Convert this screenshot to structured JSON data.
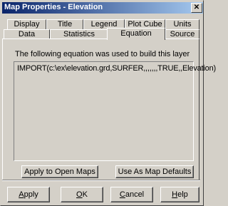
{
  "window": {
    "title": "Map Properties - Elevation",
    "close_glyph": "✕"
  },
  "tabs_top": [
    {
      "label": "Display"
    },
    {
      "label": "Title"
    },
    {
      "label": "Legend"
    },
    {
      "label": "Plot Cube"
    },
    {
      "label": "Units"
    }
  ],
  "tabs_bottom": [
    {
      "label": "Data"
    },
    {
      "label": "Statistics"
    },
    {
      "label": "Equation"
    },
    {
      "label": "Source"
    }
  ],
  "active_tab": "Equation",
  "equation": {
    "description": "The following equation was used to build this layer",
    "text": "IMPORT(c:\\ex\\elevation.grd,SURFER,,,,,,,TRUE,,Elevation)"
  },
  "actions": {
    "apply_to_open_maps": "Apply to Open Maps",
    "use_as_map_defaults": "Use As Map Defaults"
  },
  "footer": {
    "apply": {
      "mnemonic": "A",
      "rest": "pply"
    },
    "ok": {
      "mnemonic": "O",
      "rest": "K"
    },
    "cancel": {
      "mnemonic": "C",
      "rest": "ancel"
    },
    "help": {
      "mnemonic": "H",
      "rest": "elp"
    }
  }
}
